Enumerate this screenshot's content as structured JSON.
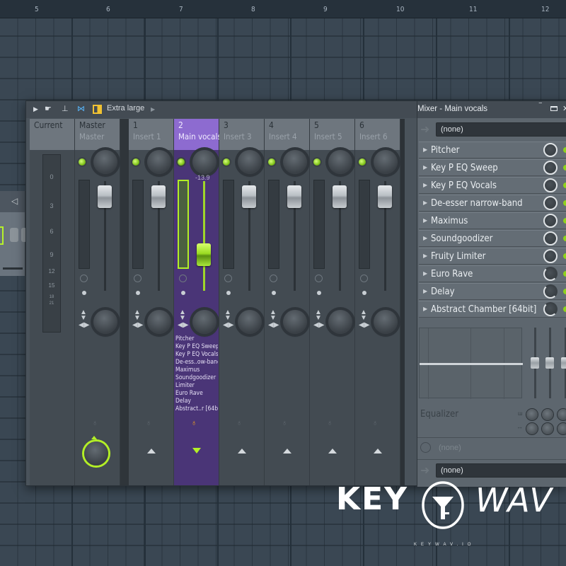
{
  "ruler": {
    "bars": [
      "5",
      "6",
      "7",
      "8",
      "9",
      "10",
      "11",
      "12"
    ]
  },
  "toolbar": {
    "icons": [
      "arrow-right-icon",
      "hand-pointer-icon",
      "pin-icon",
      "link-icon",
      "layout-icon"
    ],
    "size_label": "Extra large"
  },
  "mixer": {
    "current_label": "Current",
    "scale": [
      "0",
      "3",
      "6",
      "9",
      "12",
      "15",
      "18",
      "21"
    ],
    "strips": [
      {
        "num": "Master",
        "name": "Master",
        "selected": false
      },
      {
        "num": "1",
        "name": "Insert 1",
        "selected": false
      },
      {
        "num": "2",
        "name": "Main vocals",
        "selected": true,
        "volume_readout": "-13.9"
      },
      {
        "num": "3",
        "name": "Insert 3",
        "selected": false
      },
      {
        "num": "4",
        "name": "Insert 4",
        "selected": false
      },
      {
        "num": "5",
        "name": "Insert 5",
        "selected": false
      },
      {
        "num": "6",
        "name": "Insert 6",
        "selected": false
      }
    ],
    "selected_fx_list": [
      "Pitcher",
      "Key P EQ Sweep",
      "Key P EQ Vocals",
      "De-ess..ow-band",
      "Maximus",
      "Soundgoodizer",
      "Limiter",
      "Euro Rave",
      "Delay",
      "Abstract..r [64bit]"
    ]
  },
  "panel": {
    "title": "Mixer - Main vocals",
    "input_select": "(none)",
    "slots": [
      {
        "label": "Pitcher",
        "mix_full": true
      },
      {
        "label": "Key P EQ Sweep",
        "mix_full": true
      },
      {
        "label": "Key P EQ Vocals",
        "mix_full": true
      },
      {
        "label": "De-esser narrow-band",
        "mix_full": true
      },
      {
        "label": "Maximus",
        "mix_full": true
      },
      {
        "label": "Soundgoodizer",
        "mix_full": true
      },
      {
        "label": "Fruity Limiter",
        "mix_full": true
      },
      {
        "label": "Euro Rave",
        "mix_full": false
      },
      {
        "label": "Delay",
        "mix_full": false
      },
      {
        "label": "Abstract Chamber [64bit]",
        "mix_full": false
      }
    ],
    "eq_label": "Equalizer",
    "latency_value": "(none)",
    "output_select": "(none)"
  },
  "watermark": {
    "brand_left": "KEY",
    "brand_right": "WAV",
    "url": "KEYWAV.IO"
  }
}
